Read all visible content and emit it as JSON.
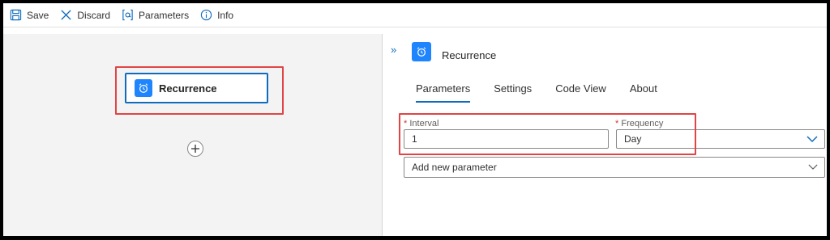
{
  "toolbar": {
    "save_label": "Save",
    "discard_label": "Discard",
    "parameters_label": "Parameters",
    "info_label": "Info"
  },
  "canvas": {
    "trigger_label": "Recurrence"
  },
  "panel": {
    "title": "Recurrence",
    "tabs": [
      {
        "label": "Parameters"
      },
      {
        "label": "Settings"
      },
      {
        "label": "Code View"
      },
      {
        "label": "About"
      }
    ],
    "interval": {
      "required_mark": "*",
      "label": "Interval",
      "value": "1"
    },
    "frequency": {
      "required_mark": "*",
      "label": "Frequency",
      "value": "Day"
    },
    "add_param": {
      "label": "Add new parameter"
    }
  },
  "colors": {
    "accent": "#0f6cbd",
    "icon_tile": "#1f85ff",
    "highlight": "#e04545"
  }
}
